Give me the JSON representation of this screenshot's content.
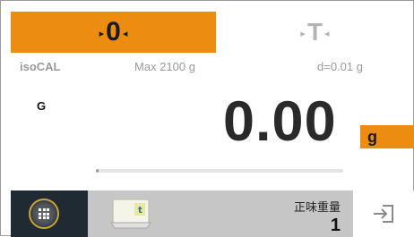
{
  "tabs": {
    "zero": {
      "label": "0",
      "arrow_left": "▸",
      "arrow_right": "◂"
    },
    "tare": {
      "label": "T",
      "arrow_left": "▸",
      "arrow_right": "◂"
    }
  },
  "info": {
    "calibration": "isoCAL",
    "max": "Max 2100 g",
    "readability": "d=0.01 g"
  },
  "display": {
    "mode": "G",
    "value": "0.00",
    "unit": "g",
    "capacity_used_fraction": 0.01
  },
  "bottom": {
    "app_name": "正味重量",
    "app_count": "1"
  },
  "colors": {
    "accent": "#ec8c10",
    "menu_bg": "#1f2a33",
    "app_bar_bg": "#c6c6c6"
  },
  "icons": {
    "menu": "menu-grid-icon",
    "app": "weighing-app-icon",
    "exit": "logout-icon"
  }
}
